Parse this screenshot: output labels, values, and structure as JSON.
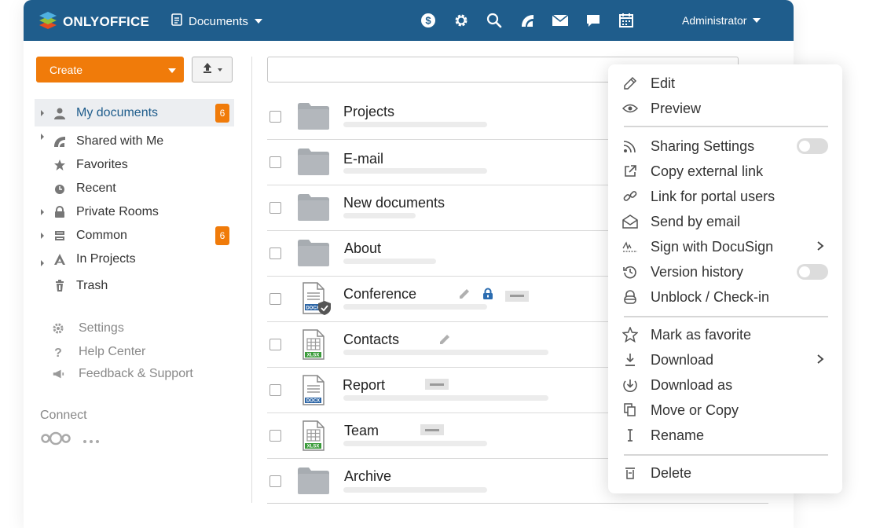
{
  "header": {
    "logo_text": "ONLYOFFICE",
    "module_label": "Documents",
    "user_label": "Administrator",
    "brand_color": "#1f5d8c"
  },
  "toolbar": {
    "create_label": "Create",
    "search_placeholder": ""
  },
  "sidebar": {
    "items": [
      {
        "label": "My documents",
        "badge": "6"
      },
      {
        "label": "Shared with Me"
      },
      {
        "label": "Favorites"
      },
      {
        "label": "Recent"
      },
      {
        "label": "Private Rooms"
      },
      {
        "label": "Common",
        "badge": "6"
      },
      {
        "label": "In Projects"
      },
      {
        "label": "Trash"
      }
    ],
    "secondary": [
      {
        "label": "Settings"
      },
      {
        "label": "Help Center"
      },
      {
        "label": "Feedback & Support"
      }
    ],
    "connect_label": "Connect"
  },
  "files": [
    {
      "name": "Projects",
      "type": "folder"
    },
    {
      "name": "E-mail",
      "type": "folder"
    },
    {
      "name": "New documents",
      "type": "folder"
    },
    {
      "name": "About",
      "type": "folder"
    },
    {
      "name": "Conference",
      "type": "docx",
      "type_label": "DOCX"
    },
    {
      "name": "Contacts",
      "type": "xlsx",
      "type_label": "XLSX"
    },
    {
      "name": "Report",
      "type": "docx",
      "type_label": "DOCX"
    },
    {
      "name": "Team",
      "type": "xlsx",
      "type_label": "XLSX"
    },
    {
      "name": "Archive",
      "type": "folder"
    }
  ],
  "context_menu": {
    "items": [
      {
        "label": "Edit",
        "icon": "pencil-icon"
      },
      {
        "label": "Preview",
        "icon": "eye-icon"
      },
      {
        "label": "Sharing Settings",
        "icon": "rss-icon"
      },
      {
        "label": "Copy external link",
        "icon": "external-link-icon"
      },
      {
        "label": "Link for portal users",
        "icon": "chain-link-icon"
      },
      {
        "label": "Send by email",
        "icon": "envelope-icon"
      },
      {
        "label": "Sign with DocuSign",
        "icon": "signature-icon"
      },
      {
        "label": "Version history",
        "icon": "history-icon"
      },
      {
        "label": "Unblock / Check-in",
        "icon": "unlock-icon"
      },
      {
        "label": "Mark as favorite",
        "icon": "star-icon"
      },
      {
        "label": "Download",
        "icon": "download-icon"
      },
      {
        "label": "Download as",
        "icon": "download-as-icon"
      },
      {
        "label": "Move or Copy",
        "icon": "copy-icon"
      },
      {
        "label": "Rename",
        "icon": "text-cursor-icon"
      },
      {
        "label": "Delete",
        "icon": "trash-icon"
      }
    ]
  },
  "colors": {
    "accent": "#f07b0a",
    "active_link": "#1f5d8c",
    "lock_blue": "#2b6cb0"
  }
}
